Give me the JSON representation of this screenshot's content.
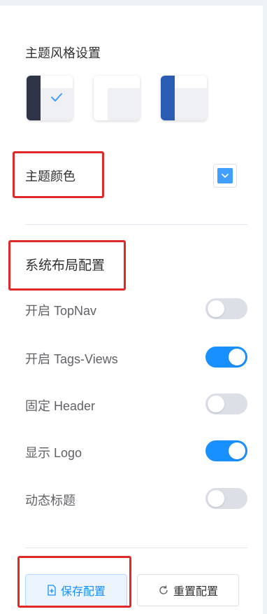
{
  "settings": {
    "style_title": "主题风格设置",
    "themes": [
      {
        "name": "dark",
        "selected": true,
        "icon": "check-icon"
      },
      {
        "name": "light",
        "selected": false
      },
      {
        "name": "blue",
        "selected": false
      }
    ],
    "theme_color_label": "主题颜色",
    "theme_color": "#409eff",
    "layout_title": "系统布局配置",
    "toggles": [
      {
        "label": "开启 TopNav",
        "on": false
      },
      {
        "label": "开启 Tags-Views",
        "on": true
      },
      {
        "label": "固定 Header",
        "on": false
      },
      {
        "label": "显示 Logo",
        "on": true
      },
      {
        "label": "动态标题",
        "on": false
      }
    ],
    "save_label": "保存配置",
    "reset_label": "重置配置",
    "accent_color": "#1890ff",
    "highlight_color": "#e02a2a"
  }
}
